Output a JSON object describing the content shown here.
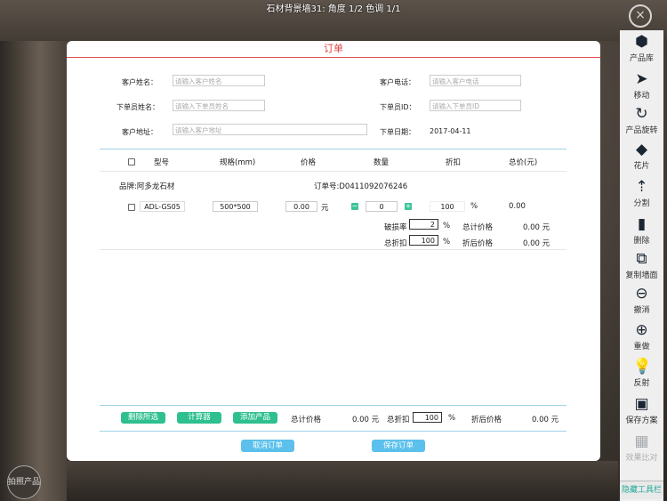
{
  "scene_title": "石材背景墙31: 角度 1/2 色调 1/1",
  "photo_button": "拍照产品",
  "close_icon": "×",
  "toolbar": [
    {
      "label": "产品库",
      "icon": "cubes-icon",
      "glyph": "⬢"
    },
    {
      "label": "移动",
      "icon": "arrow-icon",
      "glyph": "➤"
    },
    {
      "label": "产品旋转",
      "icon": "rotate-icon",
      "glyph": "↻"
    },
    {
      "label": "花片",
      "icon": "diamond-icon",
      "glyph": "◆"
    },
    {
      "label": "分割",
      "icon": "split-icon",
      "glyph": "⇡"
    },
    {
      "label": "删除",
      "icon": "trash-icon",
      "glyph": "▮"
    },
    {
      "label": "复制墙面",
      "icon": "copy-icon",
      "glyph": "⧉"
    },
    {
      "label": "撤消",
      "icon": "undo-icon",
      "glyph": "⊖"
    },
    {
      "label": "重做",
      "icon": "redo-icon",
      "glyph": "⊕"
    },
    {
      "label": "反射",
      "icon": "bulb-icon",
      "glyph": "💡"
    },
    {
      "label": "保存方案",
      "icon": "save-icon",
      "glyph": "▣"
    },
    {
      "label": "效果比对",
      "icon": "compare-icon",
      "glyph": "▦"
    }
  ],
  "hide_toolbar": "隐藏工具栏",
  "dialog": {
    "title": "订单",
    "fields": {
      "customer_name_label": "客户姓名：",
      "customer_name_placeholder": "请输入客户姓名",
      "customer_phone_label": "客户电话：",
      "customer_phone_placeholder": "请输入客户电话",
      "staff_name_label": "下单员姓名：",
      "staff_name_placeholder": "请输入下单员姓名",
      "staff_id_label": "下单员ID：",
      "staff_id_placeholder": "请输入下单员ID",
      "address_label": "客户地址：",
      "address_placeholder": "请输入客户地址",
      "order_date_label": "下单日期：",
      "order_date": "2017-04-11"
    },
    "columns": [
      "型号",
      "规格(mm)",
      "价格",
      "数量",
      "折扣",
      "总价(元)"
    ],
    "brand": "品牌:阿多龙石材",
    "order_no": "订单号:D0411092076246",
    "row": {
      "model": "ADL-GS05",
      "spec": "500*500",
      "price": "0.00",
      "price_unit": "元",
      "qty": "0",
      "discount": "100",
      "discount_unit": "%",
      "total": "0.00"
    },
    "summary": {
      "loss_rate_label": "破损率",
      "loss_rate": "2",
      "loss_unit": "%",
      "total_price_label": "总计价格",
      "total_price": "0.00 元",
      "total_discount_label": "总折扣",
      "total_discount": "100",
      "discount_unit": "%",
      "after_discount_label": "折后价格",
      "after_discount": "0.00 元"
    },
    "footer": {
      "delete_selected": "删除所选",
      "calculator": "计算器",
      "add_product": "添加产品",
      "total_price_label": "总计价格",
      "total_price": "0.00 元",
      "total_discount_label": "总折扣",
      "total_discount": "100",
      "discount_unit": "%",
      "after_discount_label": "折后价格",
      "after_discount": "0.00 元"
    },
    "cancel_button": "取消订单",
    "save_button": "保存订单"
  }
}
